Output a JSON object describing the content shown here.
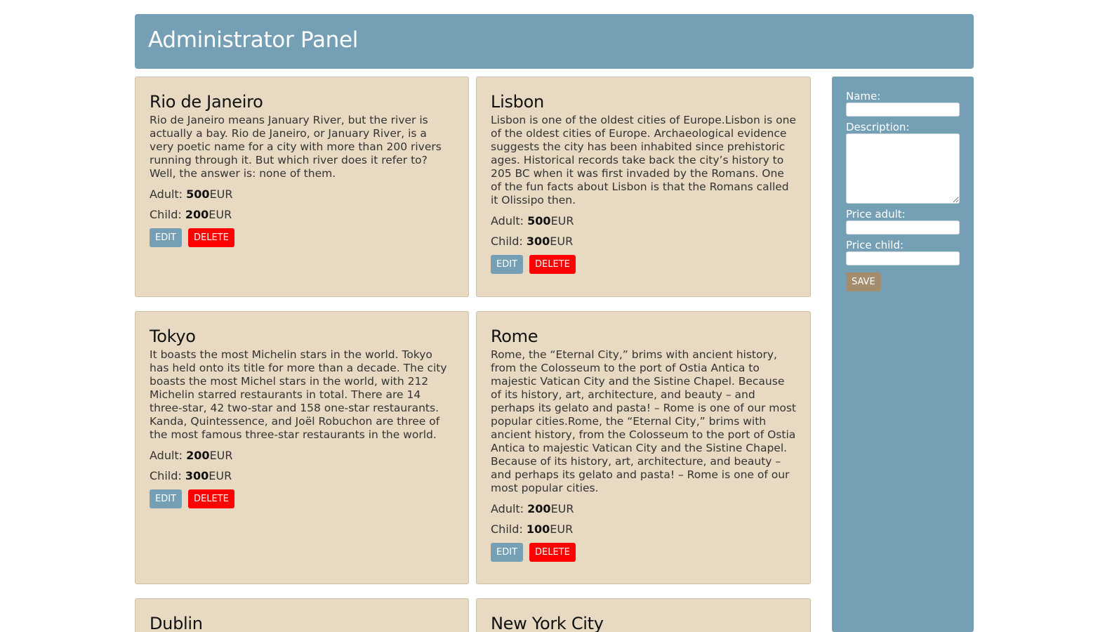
{
  "header": {
    "title": "Administrator Panel"
  },
  "labels": {
    "adult": "Adult: ",
    "child": "Child: ",
    "currency": "EUR",
    "edit": "EDIT",
    "delete": "DELETE"
  },
  "cities": [
    {
      "name": "Rio de Janeiro",
      "description": "Rio de Janeiro means January River, but the river is actually a bay. Rio de Janeiro, or January River, is a very poetic name for a city with more than 200 rivers running through it. But which river does it refer to? Well, the answer is: none of them.",
      "adult": "500",
      "child": "200"
    },
    {
      "name": "Lisbon",
      "description": "Lisbon is one of the oldest cities of Europe.Lisbon is one of the oldest cities of Europe. Archaeological evidence suggests the city has been inhabited since prehistoric ages. Historical records take back the city’s history to 205 BC when it was first invaded by the Romans. One of the fun facts about Lisbon is that the Romans called it Olissipo then.",
      "adult": "500",
      "child": "300"
    },
    {
      "name": "Tokyo",
      "description": "It boasts the most Michelin stars in the world. Tokyo has held onto its title for more than a decade. The city boasts the most Michel stars in the world, with 212 Michelin starred restaurants in total. There are 14 three-star, 42 two-star and 158 one-star restaurants. Kanda, Quintessence, and Joël Robuchon are three of the most famous three-star restaurants in the world.",
      "adult": "200",
      "child": "300"
    },
    {
      "name": "Rome",
      "description": "Rome, the “Eternal City,” brims with ancient history, from the Colosseum to the port of Ostia Antica to majestic Vatican City and the Sistine Chapel. Because of its history, art, architecture, and beauty – and perhaps its gelato and pasta! – Rome is one of our most popular cities.Rome, the “Eternal City,” brims with ancient history, from the Colosseum to the port of Ostia Antica to majestic Vatican City and the Sistine Chapel. Because of its history, art, architecture, and beauty – and perhaps its gelato and pasta! – Rome is one of our most popular cities.",
      "adult": "200",
      "child": "100"
    },
    {
      "name": "Dublin"
    },
    {
      "name": "New York City"
    }
  ],
  "form": {
    "name_label": "Name:",
    "description_label": "Description:",
    "price_adult_label": "Price adult:",
    "price_child_label": "Price child:",
    "save_label": "SAVE",
    "name_value": "",
    "description_value": "",
    "price_adult_value": "",
    "price_child_value": ""
  },
  "colors": {
    "header_bg": "#759fb4",
    "card_bg": "#e8d9c2",
    "edit_button": "#759fb4",
    "delete_button": "#ff0000",
    "save_button": "#a38d6c"
  }
}
